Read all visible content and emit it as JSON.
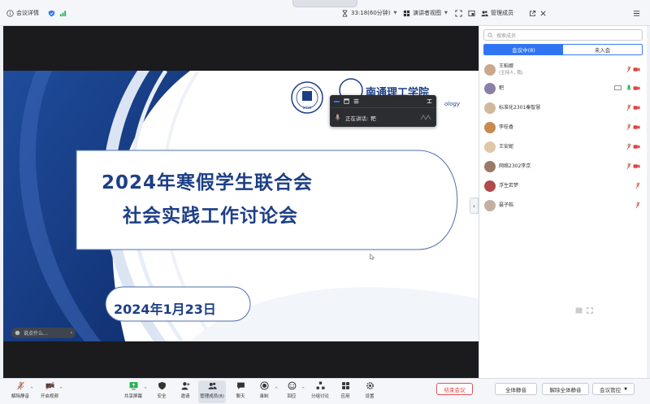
{
  "topbar": {
    "meeting_details": "会议详情",
    "timer": "33:18(60分钟)",
    "view_mode": "演讲者视图",
    "panel_title": "管理成员"
  },
  "slide": {
    "title_line1": "2024年寒假学生联合会",
    "title_line2": "社会实践工作讨论会",
    "date": "2024年1月23日",
    "university_text": "南通理工学院",
    "university_en": "ology",
    "badge_year": "2016"
  },
  "speaker_box": {
    "speaking_label": "正在讲话:",
    "speaker_name": "粑"
  },
  "chat_hint": "说点什么...",
  "panel": {
    "search_placeholder": "搜索成员",
    "tab_in_meeting": "会议中(8)",
    "tab_not_joined": "未入会",
    "members": [
      {
        "name": "王稻娜",
        "sub": "(主持人, 我)",
        "avatar_color": "#c9a98a",
        "mic": "off",
        "cam": true
      },
      {
        "name": "粑",
        "sub": "",
        "avatar_color": "#8a7fa8",
        "mic": "on",
        "cam": true,
        "screen": true
      },
      {
        "name": "标准化2301秦智慧",
        "sub": "",
        "avatar_color": "#d2b89c",
        "mic": "off",
        "cam": true
      },
      {
        "name": "李桂香",
        "sub": "",
        "avatar_color": "#c98a4f",
        "mic": "off",
        "cam": true
      },
      {
        "name": "王安妮",
        "sub": "",
        "avatar_color": "#e0c7a8",
        "mic": "off",
        "cam": true
      },
      {
        "name": "网络2302李京",
        "sub": "",
        "avatar_color": "#9a7a66",
        "mic": "off",
        "cam": true
      },
      {
        "name": "浮生若梦",
        "sub": "",
        "avatar_color": "#b14a4a",
        "mic": "off",
        "cam": false
      },
      {
        "name": "聂子皓",
        "sub": "",
        "avatar_color": "#c4b0a0",
        "mic": "off",
        "cam": false
      }
    ]
  },
  "toolbar": {
    "unmute": "解除静音",
    "start_video": "开启视频",
    "share_screen": "共享屏幕",
    "security": "安全",
    "invite": "邀请",
    "manage_members": "管理成员(8)",
    "chat": "聊天",
    "record": "录制",
    "reactions": "回应",
    "breakout": "分组讨论",
    "apps": "应用",
    "settings": "设置",
    "end_meeting": "结束会议",
    "mute_all": "全体静音",
    "unmute_all": "解除全体静音",
    "meeting_control": "会议管控"
  },
  "colors": {
    "accent": "#2f74f3",
    "slide_blue": "#1d3f86",
    "end_red": "#e04040"
  }
}
